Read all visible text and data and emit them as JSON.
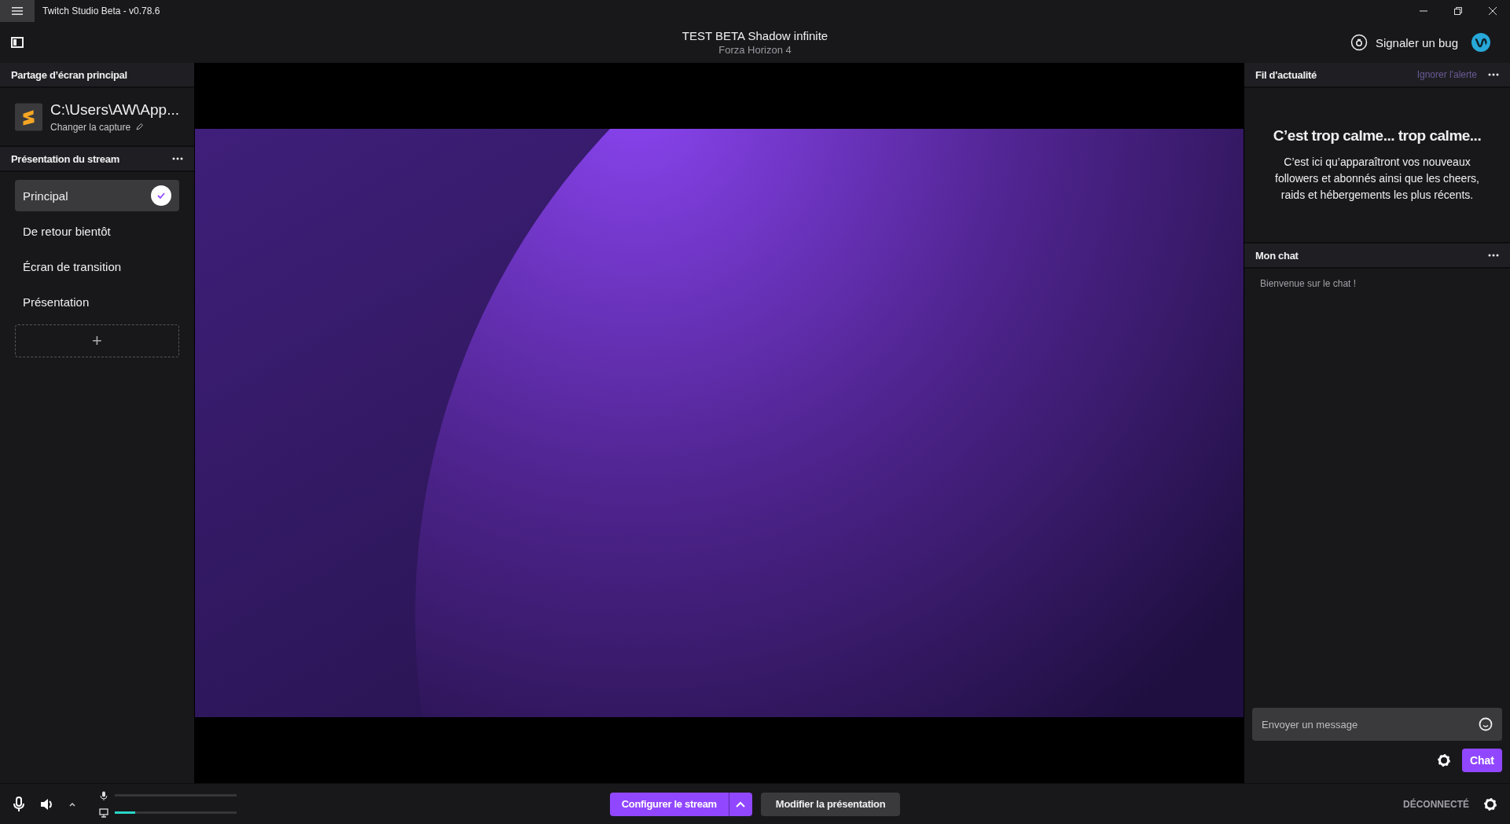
{
  "window": {
    "title": "Twitch Studio Beta - v0.78.6"
  },
  "header": {
    "stream_title": "TEST BETA Shadow infinite",
    "game": "Forza Horizon 4",
    "bug_report": "Signaler un bug"
  },
  "capture": {
    "section_title": "Partage d’écran principal",
    "name": "C:\\Users\\AW\\App...",
    "change_label": "Changer la capture"
  },
  "scenes": {
    "section_title": "Présentation du stream",
    "items": [
      {
        "label": "Principal",
        "selected": true
      },
      {
        "label": "De retour bientôt",
        "selected": false
      },
      {
        "label": "Écran de transition",
        "selected": false
      },
      {
        "label": "Présentation",
        "selected": false
      }
    ],
    "add_label": "+"
  },
  "activity_feed": {
    "title": "Fil d'actualité",
    "dismiss": "Ignorer l'alerte",
    "empty_title": "C’est trop calme... trop calme...",
    "empty_text": "C’est ici qu’apparaîtront vos nouveaux followers et abonnés ainsi que les cheers, raids et hébergements les plus récents."
  },
  "chat": {
    "title": "Mon chat",
    "welcome": "Bienvenue sur le chat !",
    "placeholder": "Envoyer un message",
    "send": "Chat"
  },
  "audio": {
    "meters": [
      {
        "kind": "microphone"
      },
      {
        "kind": "desktop",
        "level": 0.17
      }
    ]
  },
  "bottom": {
    "configure": "Configurer le stream",
    "edit_layout": "Modifier la présentation",
    "status": "DÉCONNECTÉ"
  }
}
